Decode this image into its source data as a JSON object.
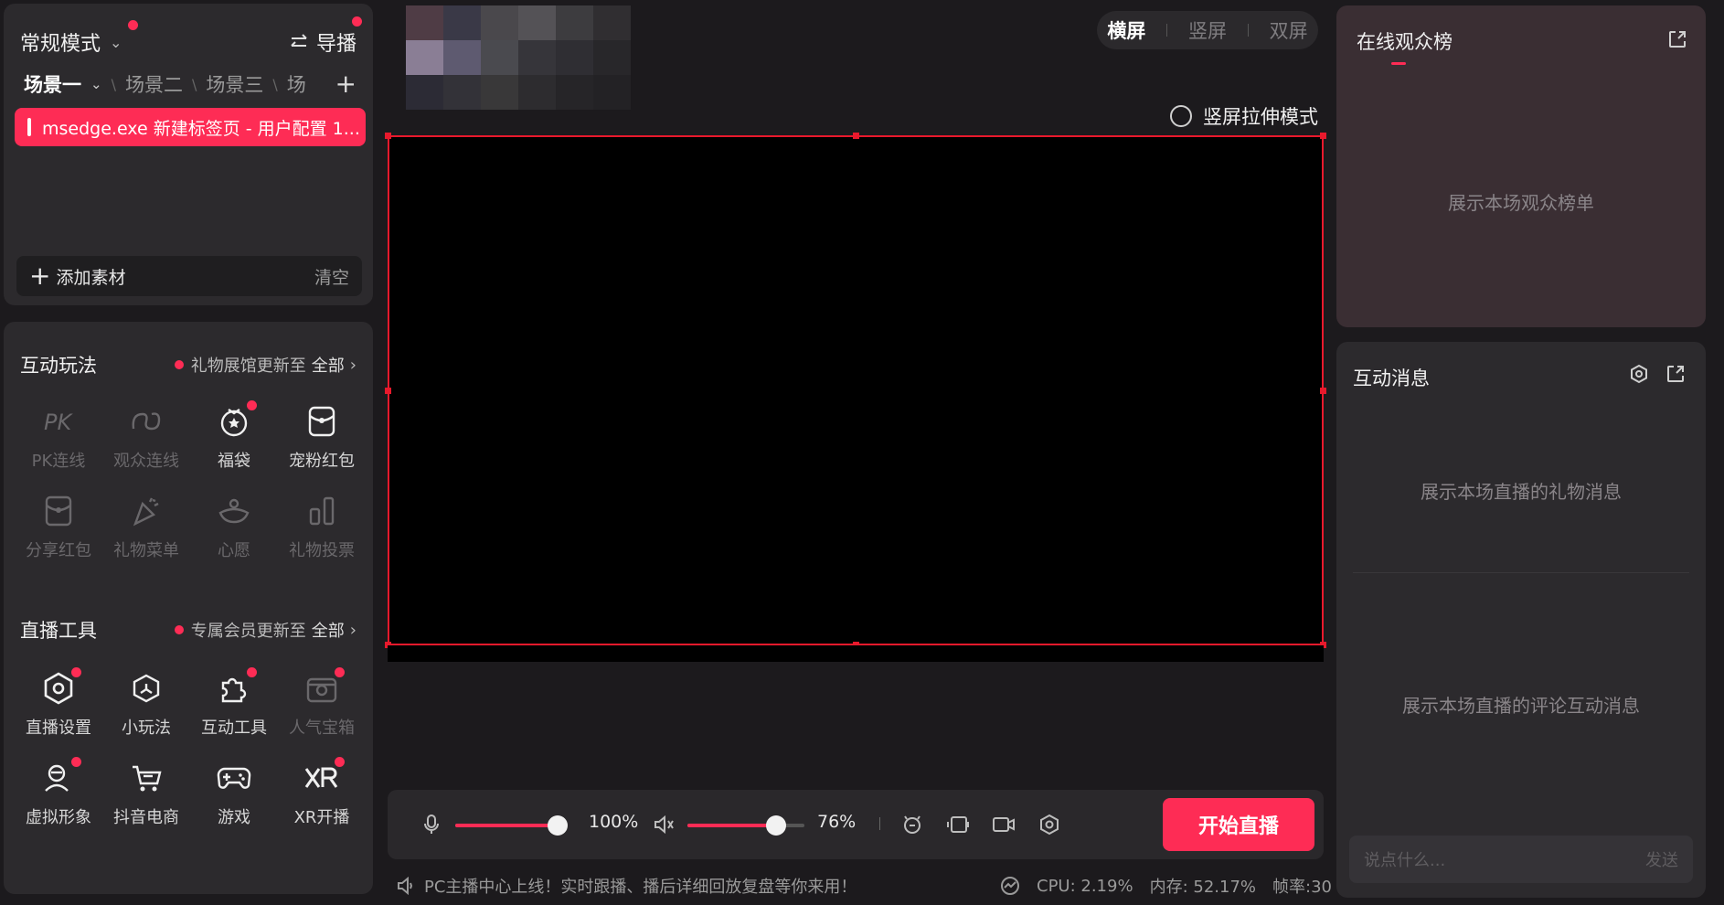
{
  "colors": {
    "accent": "#fe2c55",
    "panel": "#2c2a2d",
    "background": "#1c1a1d",
    "preview_border": "#e8192c"
  },
  "scene_panel": {
    "mode_label": "常规模式",
    "director_label": "导播",
    "tabs": [
      "场景一",
      "场景二",
      "场景三",
      "场"
    ],
    "source_item": "msedge.exe 新建标签页 - 用户配置 1...",
    "add_label": "添加素材",
    "clear_label": "清空"
  },
  "interactive": {
    "title": "互动玩法",
    "note": "礼物展馆更新至",
    "all": "全部",
    "items": [
      {
        "label": "PK连线",
        "icon": "pk-icon"
      },
      {
        "label": "观众连线",
        "icon": "audience-link-icon"
      },
      {
        "label": "福袋",
        "icon": "lucky-bag-icon"
      },
      {
        "label": "宠粉红包",
        "icon": "fan-red-packet-icon"
      },
      {
        "label": "分享红包",
        "icon": "share-red-packet-icon"
      },
      {
        "label": "礼物菜单",
        "icon": "gift-menu-icon"
      },
      {
        "label": "心愿",
        "icon": "wish-icon"
      },
      {
        "label": "礼物投票",
        "icon": "gift-vote-icon"
      }
    ]
  },
  "live_tools": {
    "title": "直播工具",
    "note": "专属会员更新至",
    "all": "全部",
    "items": [
      {
        "label": "直播设置",
        "icon": "live-settings-icon"
      },
      {
        "label": "小玩法",
        "icon": "mini-game-icon"
      },
      {
        "label": "互动工具",
        "icon": "interactive-tool-icon"
      },
      {
        "label": "人气宝箱",
        "icon": "popularity-box-icon"
      },
      {
        "label": "虚拟形象",
        "icon": "avatar-icon"
      },
      {
        "label": "抖音电商",
        "icon": "shop-cart-icon"
      },
      {
        "label": "游戏",
        "icon": "gamepad-icon"
      },
      {
        "label": "XR开播",
        "icon": "xr-icon"
      }
    ]
  },
  "orientation": {
    "landscape": "横屏",
    "portrait": "竖屏",
    "dual": "双屏"
  },
  "stretch_mode": "竖屏拉伸模式",
  "controls": {
    "mic_volume": "100%",
    "mic_level": 1.0,
    "speaker_volume": "76%",
    "speaker_level": 0.76,
    "start_label": "开始直播"
  },
  "status": {
    "notice": "PC主播中心上线！实时跟播、播后详细回放复盘等你来用！",
    "cpu": "CPU: 2.19%",
    "memory": "内存: 52.17%",
    "fps": "帧率:30"
  },
  "rank": {
    "title": "在线观众榜",
    "empty": "展示本场观众榜单"
  },
  "messages": {
    "title": "互动消息",
    "gift_empty": "展示本场直播的礼物消息",
    "comment_empty": "展示本场直播的评论互动消息",
    "input_placeholder": "说点什么...",
    "send_label": "发送"
  }
}
